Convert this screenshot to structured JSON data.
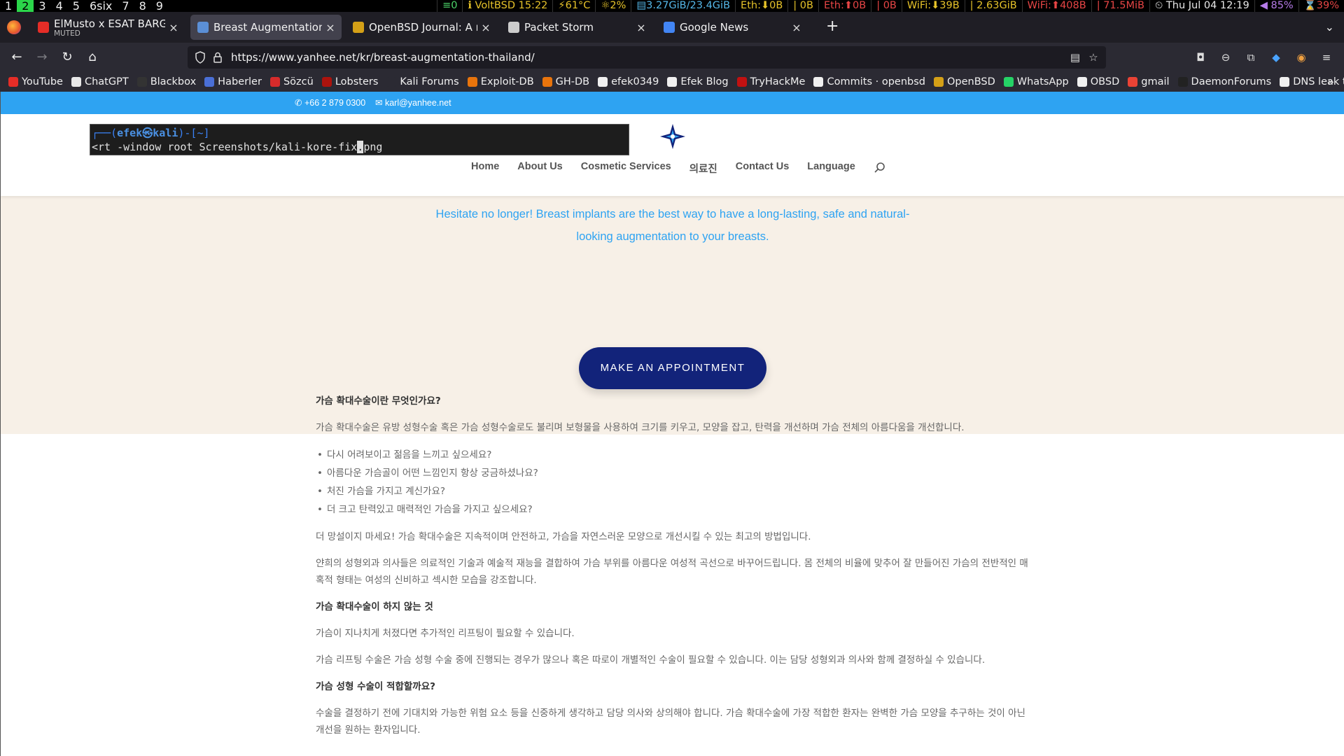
{
  "statusbar": {
    "workspaces": [
      "1",
      "2",
      "3",
      "4",
      "5",
      "6six",
      "7",
      "8",
      "9"
    ],
    "active_workspace": "2",
    "items": [
      {
        "text": "≡0",
        "color": "st-green"
      },
      {
        "text": "ℹ VoltBSD 15:22",
        "color": "st-yellow"
      },
      {
        "text": "⚡61°C",
        "color": "st-yellow"
      },
      {
        "text": "⚛2%",
        "color": "st-yellow"
      },
      {
        "text": "▤3.27GiB/23.4GiB",
        "color": "st-cyan"
      },
      {
        "text": "Eth:⬇0B",
        "color": "st-yellow"
      },
      {
        "text": "| 0B",
        "color": "st-yellow"
      },
      {
        "text": "Eth:⬆0B",
        "color": "st-red"
      },
      {
        "text": "| 0B",
        "color": "st-red"
      },
      {
        "text": "WiFi:⬇39B",
        "color": "st-yellow"
      },
      {
        "text": "| 2.63GiB",
        "color": "st-yellow"
      },
      {
        "text": "WiFi:⬆408B",
        "color": "st-red"
      },
      {
        "text": "| 71.5MiB",
        "color": "st-red"
      },
      {
        "text": "⏲ Thu Jul 04 12:19",
        "color": "st-white"
      },
      {
        "text": "◀ 85%",
        "color": "st-purple"
      },
      {
        "text": "⌛39%",
        "color": "st-red"
      }
    ]
  },
  "tabs": [
    {
      "title": "ElMusto x ESAT BARGUN",
      "subtitle": "MUTED",
      "active": false,
      "favicon_color": "#e52d27",
      "icon": "youtube-icon"
    },
    {
      "title": "Breast Augmentation Thailand",
      "subtitle": "",
      "active": true,
      "favicon_color": "#5b8fd6",
      "icon": "yanhee-icon"
    },
    {
      "title": "OpenBSD Journal: A resource",
      "subtitle": "",
      "active": false,
      "favicon_color": "#d4a017",
      "icon": "openbsd-icon"
    },
    {
      "title": "Packet Storm",
      "subtitle": "",
      "active": false,
      "favicon_color": "#cccccc",
      "icon": "packetstorm-icon"
    },
    {
      "title": "Google News",
      "subtitle": "",
      "active": false,
      "favicon_color": "#4285f4",
      "icon": "googlenews-icon"
    }
  ],
  "navbar": {
    "url": "https://www.yanhee.net/kr/breast-augmentation-thailand/"
  },
  "bookmarks": [
    {
      "label": "YouTube",
      "color": "#e52d27"
    },
    {
      "label": "ChatGPT",
      "color": "#e8e8e8"
    },
    {
      "label": "Blackbox",
      "color": "#333333"
    },
    {
      "label": "Haberler",
      "color": "#4a6fd6"
    },
    {
      "label": "Sözcü",
      "color": "#d62b2b"
    },
    {
      "label": "Lobsters",
      "color": "#ac130d"
    },
    {
      "label": "Kali Forums",
      "color": "#2b2a33"
    },
    {
      "label": "Exploit-DB",
      "color": "#e8740c"
    },
    {
      "label": "GH-DB",
      "color": "#e8740c"
    },
    {
      "label": "efek0349",
      "color": "#f0f0f0"
    },
    {
      "label": "Efek Blog",
      "color": "#f0f0f0"
    },
    {
      "label": "TryHackMe",
      "color": "#c11111"
    },
    {
      "label": "Commits · openbsd",
      "color": "#f0f0f0"
    },
    {
      "label": "OpenBSD",
      "color": "#d4a017"
    },
    {
      "label": "WhatsApp",
      "color": "#25d366"
    },
    {
      "label": "OBSD",
      "color": "#f0f0f0"
    },
    {
      "label": "gmail",
      "color": "#ea4335"
    },
    {
      "label": "DaemonForums",
      "color": "#222222"
    },
    {
      "label": "DNS leak test",
      "color": "#f0f0f0"
    }
  ],
  "site": {
    "topbar": {
      "phone": "+66 2 879 0300",
      "email": "karl@yanhee.net"
    },
    "terminal": {
      "prompt_open": "┌──(",
      "user": "efek㉿kali",
      "prompt_close": ")-[~]",
      "cmd_before": "<rt -window root Screenshots/kali-kore-fix",
      "cursor_char": ".",
      "cmd_after": "png"
    },
    "nav": [
      "Home",
      "About Us",
      "Cosmetic Services",
      "의료진",
      "Contact Us",
      "Language"
    ],
    "hero": {
      "text": "Hesitate no longer! Breast implants are the best way to have a long-lasting, safe and natural-looking augmentation to your breasts.",
      "button": "MAKE AN APPOINTMENT"
    },
    "content": {
      "h1": "가슴 확대수술이란 무엇인가요?",
      "p1": "가슴 확대수술은 유방 성형수술 혹은 가슴 성형수술로도 불리며 보형물을 사용하여 크기를 키우고, 모양을 잡고, 탄력을 개선하며 가슴 전체의 아름다움을 개선합니다.",
      "list": [
        "다시 어려보이고 젊음을 느끼고 싶으세요?",
        "아름다운 가슴골이 어떤 느낌인지 항상 궁금하셨나요?",
        "처진 가슴을 가지고 계신가요?",
        "더 크고 탄력있고 매력적인 가슴을 가지고 싶으세요?"
      ],
      "p2": "더 망설이지 마세요! 가슴 확대수술은 지속적이며 안전하고, 가슴을 자연스러운 모양으로 개선시킬 수 있는 최고의 방법입니다.",
      "p3": "얀희의 성형외과 의사들은 의료적인 기술과 예술적 재능을 결합하여 가슴 부위를 아름다운 여성적 곡선으로 바꾸어드립니다. 몸 전체의 비율에 맞추어 잘 만들어진 가슴의 전반적인 매혹적 형태는 여성의 신비하고 섹시한 모습을 강조합니다.",
      "h2": "가슴 확대수술이 하지 않는 것",
      "p4": "가슴이 지나치게 처졌다면 추가적인 리프팅이 필요할 수 있습니다.",
      "p5": "가슴 리프팅 수술은 가슴 성형 수술 중에 진행되는 경우가 많으나 혹은 따로이 개별적인 수술이 필요할 수 있습니다. 이는 담당 성형외과 의사와 함께 결정하실 수 있습니다.",
      "h3": "가슴 성형 수술이 적합할까요?",
      "p6": "수술을 결정하기 전에 기대치와 가능한 위험 요소 등을 신중하게 생각하고 담당 의사와 상의해야 합니다. 가슴 확대수술에 가장 적합한 환자는 완벽한 가슴 모양을 추구하는 것이 아닌 개선을 원하는 환자입니다."
    }
  },
  "colors": {
    "topbar": "#2ea3f2",
    "hero_bg": "#f7f0e7",
    "button": "#12237a"
  }
}
